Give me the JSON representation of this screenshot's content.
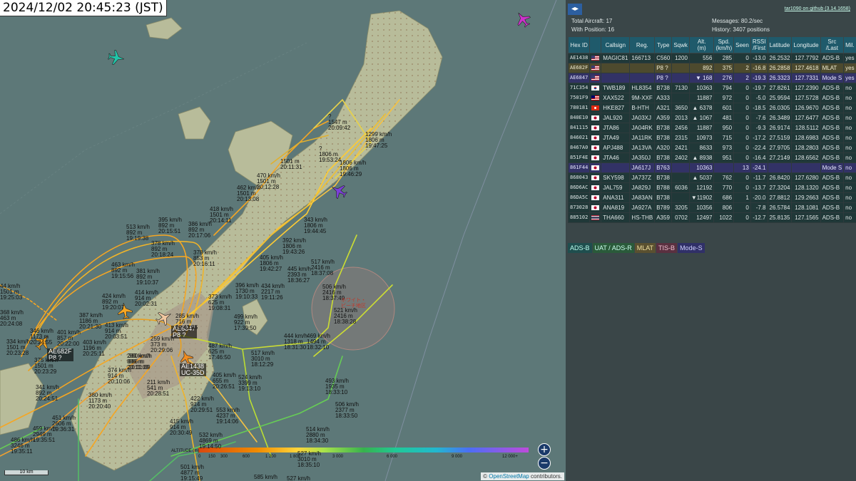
{
  "timestamp": "2024/12/02 20:45:23 (JST)",
  "map": {
    "scale_label": "10 km",
    "attribution_prefix": "© ",
    "attribution_link": "OpenStreetMap",
    "attribution_suffix": " contributors.",
    "zoom_in": "+",
    "zoom_out": "−",
    "altitude_legend": {
      "title": "ALTITUDE (m)",
      "ticks": [
        "0",
        "150",
        "300",
        "600",
        "1 200",
        "1 800",
        "3 000",
        "6 000",
        "9 000",
        "12 000+"
      ]
    },
    "aircraft_labels": [
      {
        "hex": "AE6847",
        "type": "P8 ?"
      },
      {
        "hex": "AE682F",
        "type": "P8 ?"
      },
      {
        "hex": "AE1438",
        "type": "UC-35D"
      }
    ],
    "track_labels": [
      {
        "t": "?\n1547 m\n20:09:42"
      },
      {
        "t": "1299 km/h\n1806 m\n19:47:25"
      },
      {
        "t": "?\n1806 m\n19:53:24"
      },
      {
        "t": "1806 km/h\n1806 m\n19:46:29"
      },
      {
        "t": "1501 m\n20:11:31"
      },
      {
        "t": "470 km/h\n1501 m\n20:12:28"
      },
      {
        "t": "462 km/h\n1501 m\n20:13:08"
      },
      {
        "t": "418 km/h\n1501 m\n20:14:11"
      },
      {
        "t": "343 km/h\n1806 m\n19:44:45"
      },
      {
        "t": "513 km/h\n892 m\n19:19:38"
      },
      {
        "t": "395 km/h\n892 m\n20:15:51"
      },
      {
        "t": "386 km/h\n892 m\n20:17:06"
      },
      {
        "t": "378 km/h\n892 m\n20:18:24"
      },
      {
        "t": "392 km/h\n1806 m\n19:43:26"
      },
      {
        "t": "378 km/h\n853 m\n20:16:11"
      },
      {
        "t": "405 km/h\n1806 m\n19:42:27"
      },
      {
        "t": "517 km/h\n2416 m\n18:37:08"
      },
      {
        "t": "463 km/h\n892 m\n19:15:56"
      },
      {
        "t": "381 km/h\n892 m\n19:10:37"
      },
      {
        "t": "445 km/h\n2393 m\n18:36:27"
      },
      {
        "t": "424 km/h\n892 m\n19:20:07"
      },
      {
        "t": "414 km/h\n914 m\n20:02:31"
      },
      {
        "t": "396 km/h\n1730 m\n19:10:33"
      },
      {
        "t": "434 km/h\n2217 m\n19:11:26"
      },
      {
        "t": "506 km/h\n2416 m\n18:37:49"
      },
      {
        "t": "373 km/h\n625 m\n19:08:31"
      },
      {
        "t": "387 km/h\n1186 m\n20:21:30"
      },
      {
        "t": "413 km/h\n914 m\n20:03:51"
      },
      {
        "t": "285 km/h\n716 m\n20:43:35"
      },
      {
        "t": "499 km/h\n922 m\n17:39:50"
      },
      {
        "t": "521 km/h\n2416 m\n18:38:28"
      },
      {
        "t": "346 km/h\n1173 m\n20:24:55"
      },
      {
        "t": "401 km/h\n857 m\n20:22:00"
      },
      {
        "t": "334 km/h\n1501 m\n20:23:28"
      },
      {
        "t": "403 km/h\n1196 m\n20:25:11"
      },
      {
        "t": "259 km/h\n373 m\n20:29:06"
      },
      {
        "t": "444 km/h\n1318 m\n18:31:30"
      },
      {
        "t": "469 km/h\n1494 m\n18:32:10"
      },
      {
        "t": "375 km/h\n1501 m\n20:23:29"
      },
      {
        "t": "380 km/h\n886 m\n20:11:09"
      },
      {
        "t": "283 km/h\n886 m\n20:11:09"
      },
      {
        "t": "487 km/h\n625 m\n17:46:50"
      },
      {
        "t": "517 km/h\n3010 m\n18:12:29"
      },
      {
        "t": "374 km/h\n914 m\n20:10:06"
      },
      {
        "t": "211 km/h\n541 m\n20:28:51"
      },
      {
        "t": "405 km/h\n655 m\n20:26:51"
      },
      {
        "t": "524 km/h\n3399 m\n19:13:10"
      },
      {
        "t": "493 km/h\n1935 m\n18:33:10"
      },
      {
        "t": "341 km/h\n892 m\n20:24:51"
      },
      {
        "t": "380 km/h\n1173 m\n20:20:40"
      },
      {
        "t": "422 km/h\n914 m\n20:29:51"
      },
      {
        "t": "553 km/h\n4237 m\n19:14:06"
      },
      {
        "t": "506 km/h\n2377 m\n18:33:50"
      },
      {
        "t": "451 km/h\n2606 m\n19:36:31"
      },
      {
        "t": "459 km/h\n2949 m\n19:35:51"
      },
      {
        "t": "415 km/h\n914 m\n20:30:49"
      },
      {
        "t": "514 km/h\n2880 m\n18:34:30"
      },
      {
        "t": "486 km/h\n3246 m\n19:35:11"
      },
      {
        "t": "532 km/h\n4869 m\n19:14:50"
      },
      {
        "t": "527 km/h\n3010 m\n18:35:10"
      },
      {
        "t": "501 km/h\n4877 m\n19:15:49"
      },
      {
        "t": "585 km/h"
      },
      {
        "t": "527 km/h"
      },
      {
        "t": "44 km/h\n1501 m\n19:25:03"
      },
      {
        "t": "368 km/h\n463 m\n20:24:08"
      }
    ],
    "place_label": "ホワイト・ビーチ地区"
  },
  "panel": {
    "toggle_icon": "◂▸",
    "github_link": "tar1090 on github (3.14.1658)",
    "total_aircraft_label": "Total Aircraft:",
    "total_aircraft": "17",
    "with_position_label": "With Position:",
    "with_position": "16",
    "messages_label": "Messages:",
    "messages": "80.2/sec",
    "history_label": "History:",
    "history": "3407 positions",
    "columns": [
      "Hex ID",
      "",
      "Callsign",
      "Reg.",
      "Type",
      "Sqwk",
      "Alt.\n(m)",
      "Spd.\n(km/h)",
      "Seen",
      "RSSI\n/First",
      "Latitude",
      "Longitude",
      "Src\n/Last",
      "Mil."
    ],
    "rows": [
      {
        "cls": "adsb",
        "hex": "AE1438",
        "flag": "us",
        "call": "MAGIC81",
        "reg": "166713",
        "type": "C560",
        "sq": "1200",
        "alt": "556",
        "spd": "285",
        "seen": "0",
        "rssi": "-13.0",
        "lat": "26.2532",
        "lon": "127.7792",
        "src": "ADS-B",
        "mil": "yes"
      },
      {
        "cls": "mlat",
        "hex": "AE682F",
        "flag": "us",
        "call": "",
        "reg": "",
        "type": "P8 ?",
        "sq": "",
        "alt": "892",
        "spd": "375",
        "seen": "2",
        "rssi": "-16.8",
        "lat": "26.2858",
        "lon": "127.4618",
        "src": "MLAT",
        "mil": "yes"
      },
      {
        "cls": "modes",
        "hex": "AE6847",
        "flag": "us",
        "call": "",
        "reg": "",
        "type": "P8 ?",
        "sq": "",
        "alt": "▼  168",
        "spd": "276",
        "seen": "2",
        "rssi": "-19.3",
        "lat": "26.3323",
        "lon": "127.7331",
        "src": "Mode S",
        "mil": "yes"
      },
      {
        "cls": "adsb",
        "hex": "71C354",
        "flag": "kr",
        "call": "TWB189",
        "reg": "HL8354",
        "type": "B738",
        "sq": "7130",
        "alt": "10363",
        "spd": "794",
        "seen": "0",
        "rssi": "-19.7",
        "lat": "27.8261",
        "lon": "127.2390",
        "src": "ADS-B",
        "mil": "no"
      },
      {
        "cls": "adsb",
        "hex": "7501F9",
        "flag": "my",
        "call": "XAX522",
        "reg": "9M-XXF",
        "type": "A333",
        "sq": "",
        "alt": "11887",
        "spd": "972",
        "seen": "0",
        "rssi": "-5.0",
        "lat": "25.9594",
        "lon": "127.5728",
        "src": "ADS-B",
        "mil": "no"
      },
      {
        "cls": "adsb",
        "hex": "780181",
        "flag": "hk",
        "call": "HKE827",
        "reg": "B-HTH",
        "type": "A321",
        "sq": "3650",
        "alt": "▲  6378",
        "spd": "601",
        "seen": "0",
        "rssi": "-18.5",
        "lat": "26.0305",
        "lon": "126.9670",
        "src": "ADS-B",
        "mil": "no"
      },
      {
        "cls": "adsb",
        "hex": "840E10",
        "flag": "jp",
        "call": "JAL920",
        "reg": "JA03XJ",
        "type": "A359",
        "sq": "2013",
        "alt": "▲  1067",
        "spd": "481",
        "seen": "0",
        "rssi": "-7.6",
        "lat": "26.3489",
        "lon": "127.6477",
        "src": "ADS-B",
        "mil": "no"
      },
      {
        "cls": "adsb",
        "hex": "841115",
        "flag": "jp",
        "call": "JTA86",
        "reg": "JA04RK",
        "type": "B738",
        "sq": "2456",
        "alt": "11887",
        "spd": "950",
        "seen": "0",
        "rssi": "-9.3",
        "lat": "26.9174",
        "lon": "128.5112",
        "src": "ADS-B",
        "mil": "no"
      },
      {
        "cls": "adsb",
        "hex": "846021",
        "flag": "jp",
        "call": "JTA49",
        "reg": "JA11RK",
        "type": "B738",
        "sq": "2315",
        "alt": "10973",
        "spd": "715",
        "seen": "0",
        "rssi": "-17.2",
        "lat": "27.5159",
        "lon": "128.6983",
        "src": "ADS-B",
        "mil": "no"
      },
      {
        "cls": "adsb",
        "hex": "8467A0",
        "flag": "jp",
        "call": "APJ488",
        "reg": "JA13VA",
        "type": "A320",
        "sq": "2421",
        "alt": "8633",
        "spd": "973",
        "seen": "0",
        "rssi": "-22.4",
        "lat": "27.9705",
        "lon": "128.2803",
        "src": "ADS-B",
        "mil": "no"
      },
      {
        "cls": "adsb",
        "hex": "851F4E",
        "flag": "jp",
        "call": "JTA46",
        "reg": "JA350J",
        "type": "B738",
        "sq": "2402",
        "alt": "▲  8938",
        "spd": "951",
        "seen": "0",
        "rssi": "-16.4",
        "lat": "27.2149",
        "lon": "128.6562",
        "src": "ADS-B",
        "mil": "no"
      },
      {
        "cls": "modes",
        "hex": "861F44",
        "flag": "jp",
        "call": "",
        "reg": "JA617J",
        "type": "B763",
        "sq": "",
        "alt": "10363",
        "spd": "",
        "seen": "13",
        "rssi": "-24.1",
        "lat": "",
        "lon": "",
        "src": "Mode S",
        "mil": "no"
      },
      {
        "cls": "adsb",
        "hex": "868043",
        "flag": "jp",
        "call": "SKY598",
        "reg": "JA737Z",
        "type": "B738",
        "sq": "",
        "alt": "▲  5037",
        "spd": "762",
        "seen": "0",
        "rssi": "-11.7",
        "lat": "26.8420",
        "lon": "127.6280",
        "src": "ADS-B",
        "mil": "no"
      },
      {
        "cls": "adsb",
        "hex": "86D6AC",
        "flag": "jp",
        "call": "JAL759",
        "reg": "JA829J",
        "type": "B788",
        "sq": "6036",
        "alt": "12192",
        "spd": "770",
        "seen": "0",
        "rssi": "-13.7",
        "lat": "27.3204",
        "lon": "128.1320",
        "src": "ADS-B",
        "mil": "no"
      },
      {
        "cls": "adsb",
        "hex": "86DA5C",
        "flag": "jp",
        "call": "ANA311",
        "reg": "JA83AN",
        "type": "B738",
        "sq": "",
        "alt": "▼11902",
        "spd": "686",
        "seen": "1",
        "rssi": "-20.0",
        "lat": "27.8812",
        "lon": "129.2663",
        "src": "ADS-B",
        "mil": "no"
      },
      {
        "cls": "adsb",
        "hex": "873028",
        "flag": "jp",
        "call": "ANA819",
        "reg": "JA927A",
        "type": "B789",
        "sq": "3205",
        "alt": "10356",
        "spd": "806",
        "seen": "0",
        "rssi": "-7.8",
        "lat": "26.5784",
        "lon": "128.1081",
        "src": "ADS-B",
        "mil": "no"
      },
      {
        "cls": "adsb",
        "hex": "885102",
        "flag": "th",
        "call": "THA660",
        "reg": "HS-THB",
        "type": "A359",
        "sq": "0702",
        "alt": "12497",
        "spd": "1022",
        "seen": "0",
        "rssi": "-12.7",
        "lat": "25.8135",
        "lon": "127.1565",
        "src": "ADS-B",
        "mil": "no"
      }
    ],
    "legend": [
      {
        "label": "ADS-B",
        "bg": "#1f4e4e",
        "fg": "#bfe"
      },
      {
        "label": "UAT / ADS-R",
        "bg": "#2a5a3a",
        "fg": "#cfe"
      },
      {
        "label": "MLAT",
        "bg": "#5a5030",
        "fg": "#f0e0a0"
      },
      {
        "label": "TIS-B",
        "bg": "#5a3040",
        "fg": "#f0c0d0"
      },
      {
        "label": "Mode-S",
        "bg": "#303068",
        "fg": "#d0d0ff"
      }
    ]
  }
}
